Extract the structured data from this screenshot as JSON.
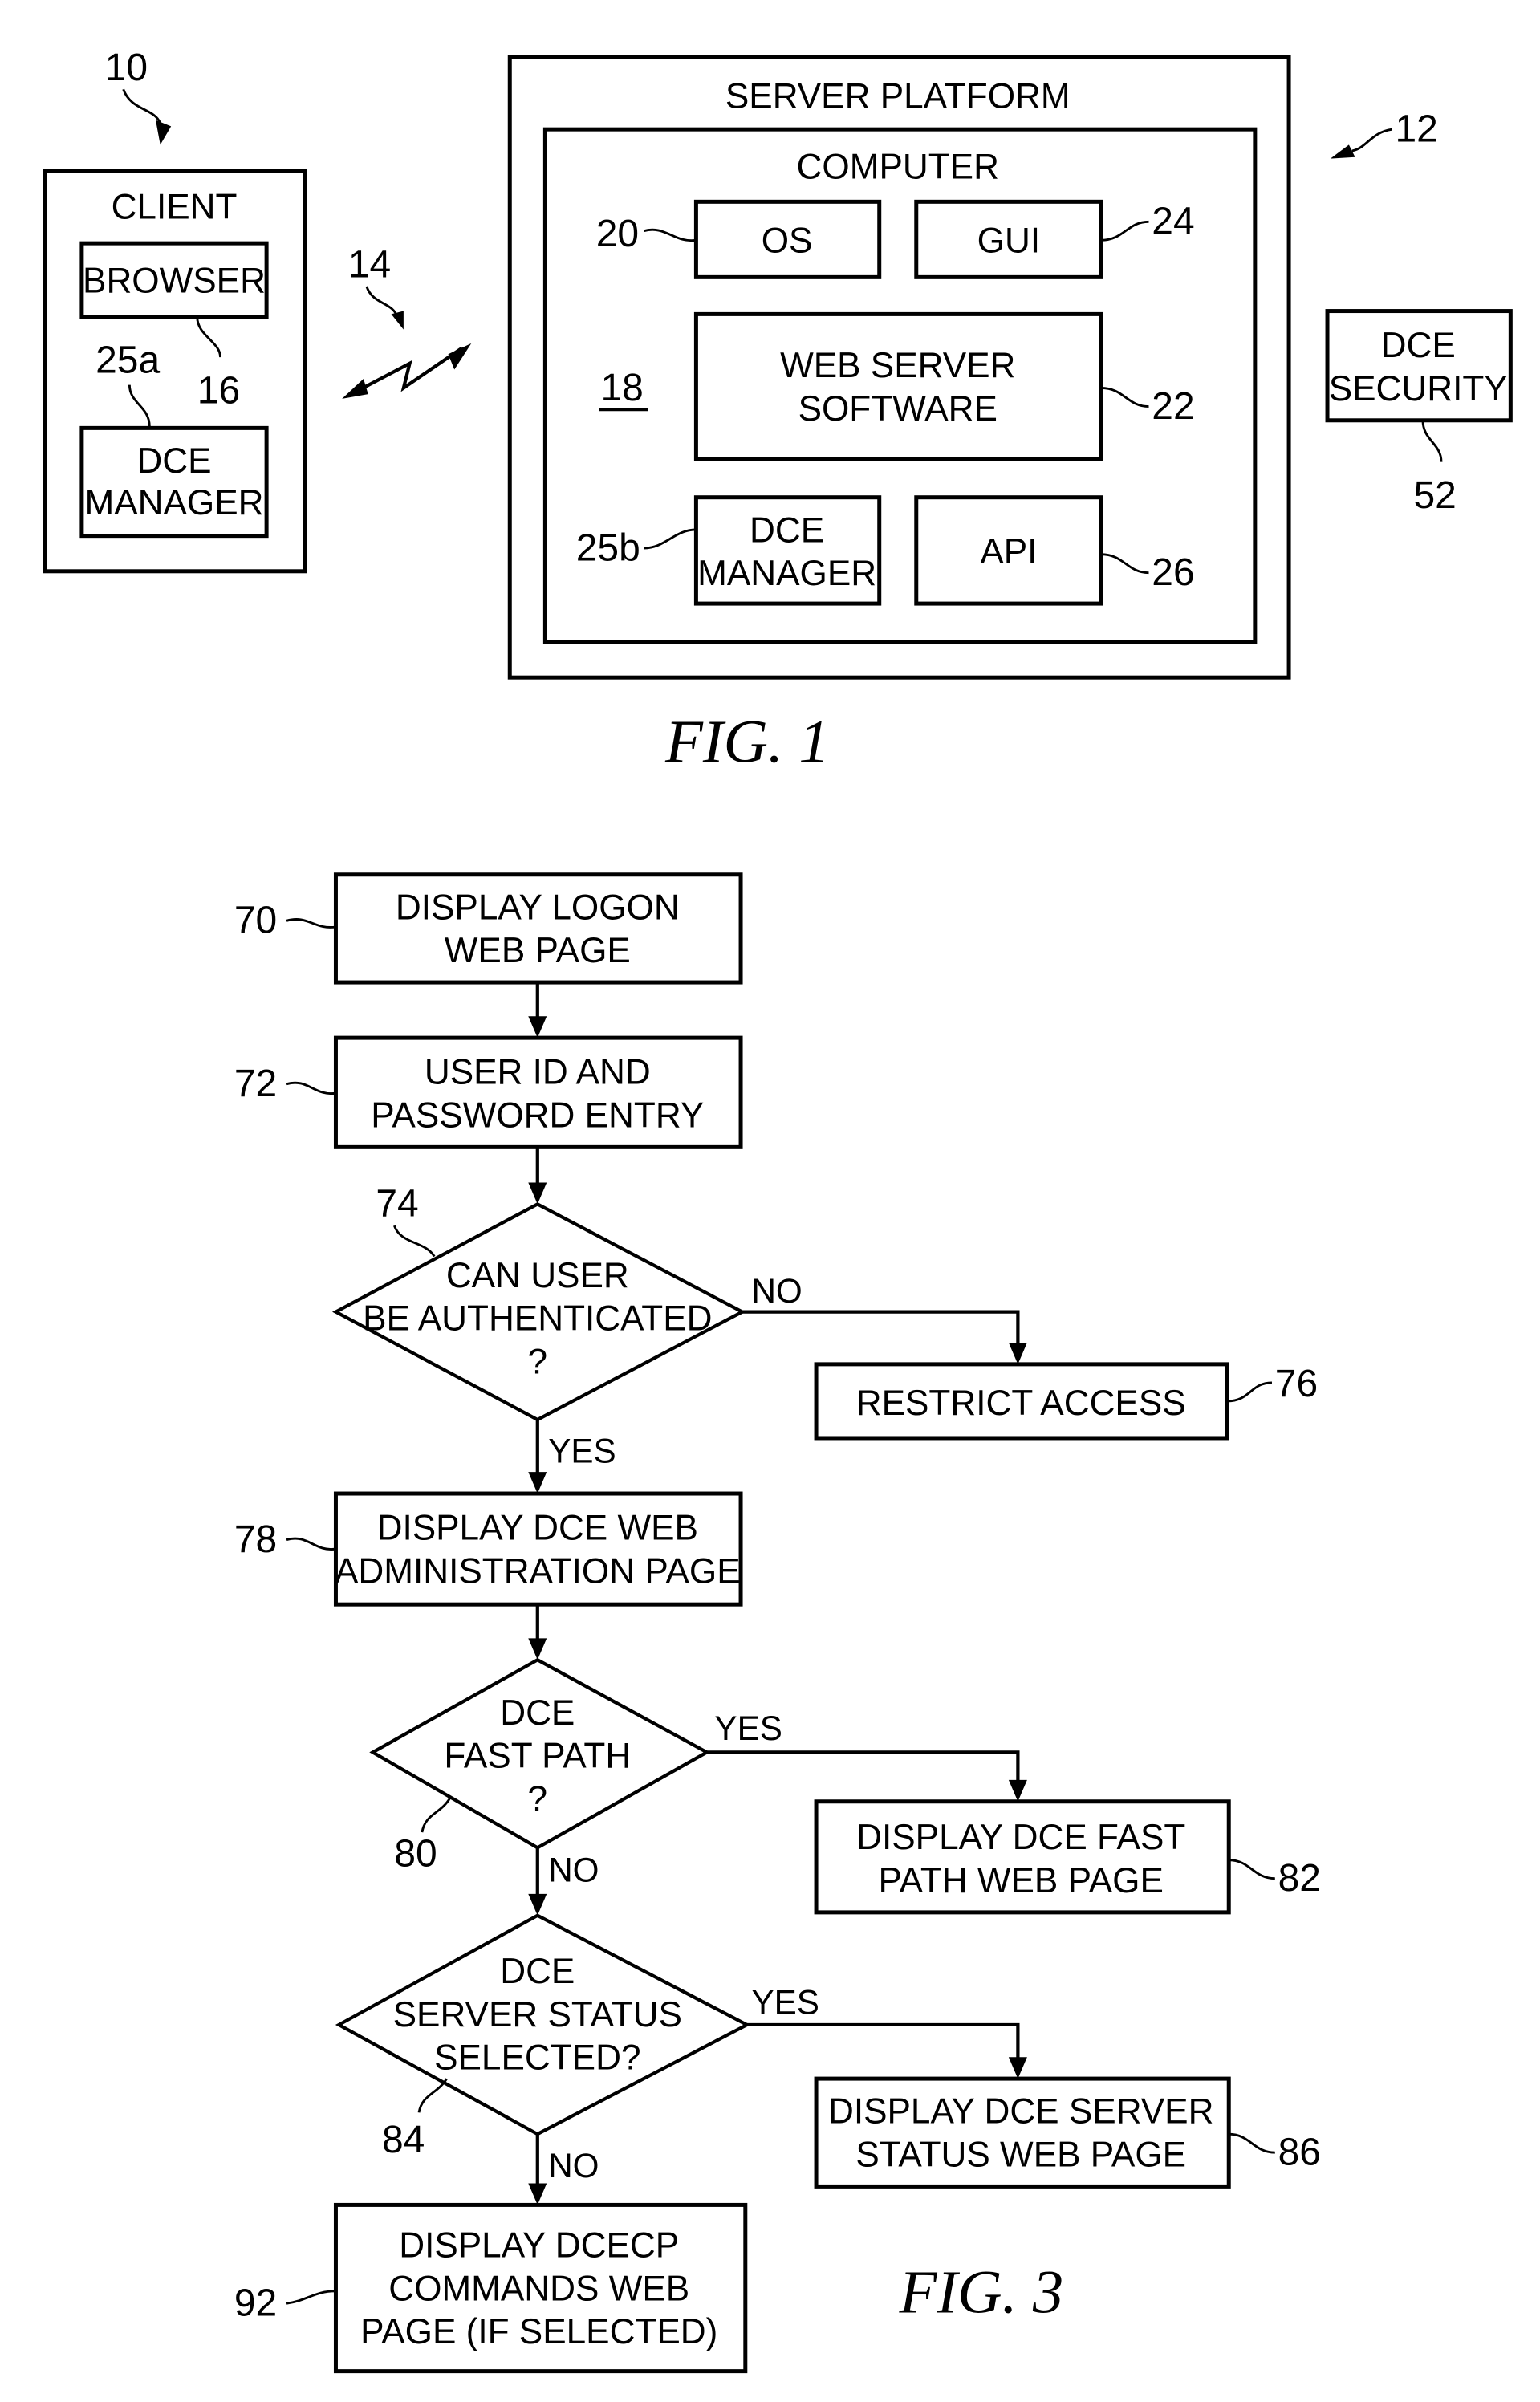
{
  "fig1": {
    "caption": "FIG. 1",
    "client": {
      "ref": "10",
      "title": "CLIENT",
      "browser": {
        "label": "BROWSER",
        "ref": "16"
      },
      "dce_manager": {
        "line1": "DCE",
        "line2": "MANAGER",
        "ref": "25a"
      }
    },
    "network": {
      "ref": "14"
    },
    "server_platform": {
      "ref": "12",
      "title": "SERVER PLATFORM",
      "computer": {
        "title": "COMPUTER",
        "ref": "18",
        "os": {
          "label": "OS",
          "ref": "20"
        },
        "gui": {
          "label": "GUI",
          "ref": "24"
        },
        "web_server": {
          "line1": "WEB SERVER",
          "line2": "SOFTWARE",
          "ref": "22"
        },
        "dce_manager": {
          "line1": "DCE",
          "line2": "MANAGER",
          "ref": "25b"
        },
        "api": {
          "label": "API",
          "ref": "26"
        }
      }
    },
    "dce_security": {
      "line1": "DCE",
      "line2": "SECURITY",
      "ref": "52"
    }
  },
  "fig3": {
    "caption": "FIG. 3",
    "steps": {
      "s70": {
        "ref": "70",
        "lines": [
          "DISPLAY LOGON",
          "WEB PAGE"
        ]
      },
      "s72": {
        "ref": "72",
        "lines": [
          "USER ID AND",
          "PASSWORD ENTRY"
        ]
      },
      "d74": {
        "ref": "74",
        "lines": [
          "CAN USER",
          "BE AUTHENTICATED",
          "?"
        ],
        "yes": "YES",
        "no": "NO"
      },
      "s76": {
        "ref": "76",
        "lines": [
          "RESTRICT ACCESS"
        ]
      },
      "s78": {
        "ref": "78",
        "lines": [
          "DISPLAY DCE WEB",
          "ADMINISTRATION PAGE"
        ]
      },
      "d80": {
        "ref": "80",
        "lines": [
          "DCE",
          "FAST PATH",
          "?"
        ],
        "yes": "YES",
        "no": "NO"
      },
      "s82": {
        "ref": "82",
        "lines": [
          "DISPLAY DCE FAST",
          "PATH WEB PAGE"
        ]
      },
      "d84": {
        "ref": "84",
        "lines": [
          "DCE",
          "SERVER STATUS",
          "SELECTED?"
        ],
        "yes": "YES",
        "no": "NO"
      },
      "s86": {
        "ref": "86",
        "lines": [
          "DISPLAY DCE SERVER",
          "STATUS WEB PAGE"
        ]
      },
      "s92": {
        "ref": "92",
        "lines": [
          "DISPLAY DCECP",
          "COMMANDS WEB",
          "PAGE (IF SELECTED)"
        ]
      }
    }
  }
}
